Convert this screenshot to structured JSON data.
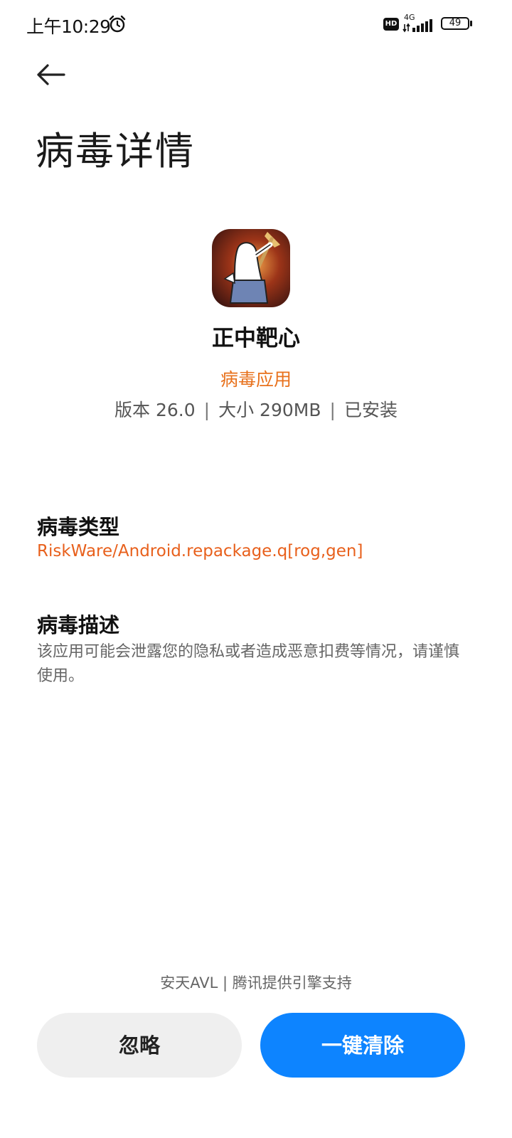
{
  "status_bar": {
    "time": "上午10:29",
    "alarm_icon": "alarm-clock-icon",
    "hd_label": "HD",
    "network_label": "4G",
    "battery_level": "49"
  },
  "header": {
    "back_icon": "back-arrow-icon",
    "title": "病毒详情"
  },
  "app": {
    "icon": "app-icon",
    "name": "正中靶心",
    "status": "病毒应用",
    "version": "版本 26.0",
    "size": "大小 290MB",
    "install_state": "已安装",
    "separator": "|"
  },
  "virus_type": {
    "heading": "病毒类型",
    "value": "RiskWare/Android.repackage.q[rog,gen]"
  },
  "virus_description": {
    "heading": "病毒描述",
    "value": "该应用可能会泄露您的隐私或者造成恶意扣费等情况，请谨慎使用。"
  },
  "footer": {
    "engine_credit": "安天AVL | 腾讯提供引擎支持",
    "ignore_label": "忽略",
    "clean_label": "一键清除"
  },
  "colors": {
    "accent_orange": "#e8711c",
    "primary_blue": "#0d84ff",
    "secondary_button": "#efefef"
  }
}
